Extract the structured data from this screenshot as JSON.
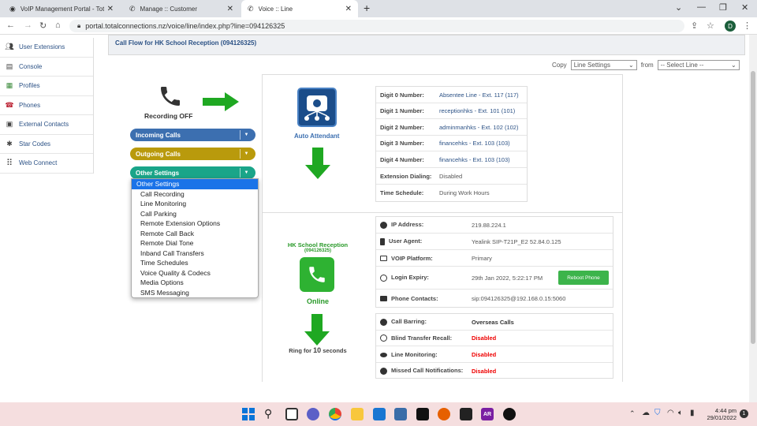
{
  "browser": {
    "tabs": [
      {
        "title": "VoIP Management Portal - Total C",
        "active": false
      },
      {
        "title": "Manage :: Customer",
        "active": false
      },
      {
        "title": "Voice :: Line",
        "active": true
      }
    ],
    "new_tab": "+",
    "url": "portal.totalconnections.nz/voice/line/index.php?line=094126325",
    "profile_initial": "D"
  },
  "sidebar": {
    "items": [
      {
        "label": "User Extensions",
        "icon": "users-icon"
      },
      {
        "label": "Console",
        "icon": "console-icon"
      },
      {
        "label": "Profiles",
        "icon": "profiles-icon"
      },
      {
        "label": "Phones",
        "icon": "phone-icon"
      },
      {
        "label": "External Contacts",
        "icon": "contacts-icon"
      },
      {
        "label": "Star Codes",
        "icon": "star-icon"
      },
      {
        "label": "Web Connect",
        "icon": "grid-icon"
      }
    ]
  },
  "header": {
    "title": "Call Flow for HK School Reception (094126325)"
  },
  "copy_bar": {
    "copy_label": "Copy",
    "copy_select": "Line Settings",
    "from_label": "from",
    "from_select": "-- Select Line --"
  },
  "left_panel": {
    "recording": "Recording OFF",
    "incoming": "Incoming Calls",
    "outgoing": "Outgoing Calls",
    "other": "Other Settings"
  },
  "dropdown_menu": {
    "items": [
      "Other Settings",
      "Call Recording",
      "Line Monitoring",
      "Call Parking",
      "Remote Extension Options",
      "Remote Call Back",
      "Remote Dial Tone",
      "Inband Call Transfers",
      "Time Schedules",
      "Voice Quality & Codecs",
      "Media Options",
      "SMS Messaging"
    ],
    "highlighted_index": 0
  },
  "auto_attendant": {
    "label": "Auto Attendant",
    "rows": [
      {
        "label": "Digit 0 Number:",
        "value": "Absentee Line - Ext. 117 (117)",
        "link": true
      },
      {
        "label": "Digit 1 Number:",
        "value": "receptionhks - Ext. 101 (101)",
        "link": true
      },
      {
        "label": "Digit 2 Number:",
        "value": "adminmanhks - Ext. 102 (102)",
        "link": true
      },
      {
        "label": "Digit 3 Number:",
        "value": "financehks - Ext. 103 (103)",
        "link": true
      },
      {
        "label": "Digit 4 Number:",
        "value": "financehks - Ext. 103 (103)",
        "link": true
      },
      {
        "label": "Extension Dialing:",
        "value": "Disabled",
        "link": false
      },
      {
        "label": "Time Schedule:",
        "value": "During Work Hours",
        "link": false
      }
    ]
  },
  "line": {
    "name": "HK School Reception",
    "number": "(094126325)",
    "status": "Online",
    "ring_prefix": "Ring for",
    "ring_seconds": "10",
    "ring_suffix": "seconds",
    "device_rows": [
      {
        "label": "IP Address:",
        "value": "219.88.224.1",
        "icon": "info-icon"
      },
      {
        "label": "User Agent:",
        "value": "Yealink SIP-T21P_E2 52.84.0.125",
        "icon": "device-icon"
      },
      {
        "label": "VOIP Platform:",
        "value": "Primary",
        "icon": "monitor-icon"
      },
      {
        "label": "Login Expiry:",
        "value": "29th Jan 2022, 5:22:17 PM",
        "icon": "clock-icon"
      },
      {
        "label": "Phone Contacts:",
        "value": "sip:094126325@192.168.0.15:5060",
        "icon": "contacts-card-icon"
      }
    ],
    "reboot_button": "Reboot Phone",
    "feature_rows": [
      {
        "label": "Call Barring:",
        "value": "Overseas Calls",
        "style": "dark",
        "icon": "barring-icon"
      },
      {
        "label": "Blind Transfer Recall:",
        "value": "Disabled",
        "style": "red",
        "icon": "refresh-icon"
      },
      {
        "label": "Line Monitoring:",
        "value": "Disabled",
        "style": "red",
        "icon": "eye-icon"
      },
      {
        "label": "Missed Call Notifications:",
        "value": "Disabled",
        "style": "red",
        "icon": "question-icon"
      }
    ]
  },
  "taskbar": {
    "time": "4:44 pm",
    "date": "29/01/2022",
    "notification_count": "1",
    "ar_label": "AR"
  },
  "colors": {
    "incoming": "#3c6fb0",
    "outgoing": "#b99a0c",
    "other": "#1aa589",
    "green_arrow": "#1fa822",
    "online_green": "#2eb232",
    "link": "#2b5185"
  }
}
